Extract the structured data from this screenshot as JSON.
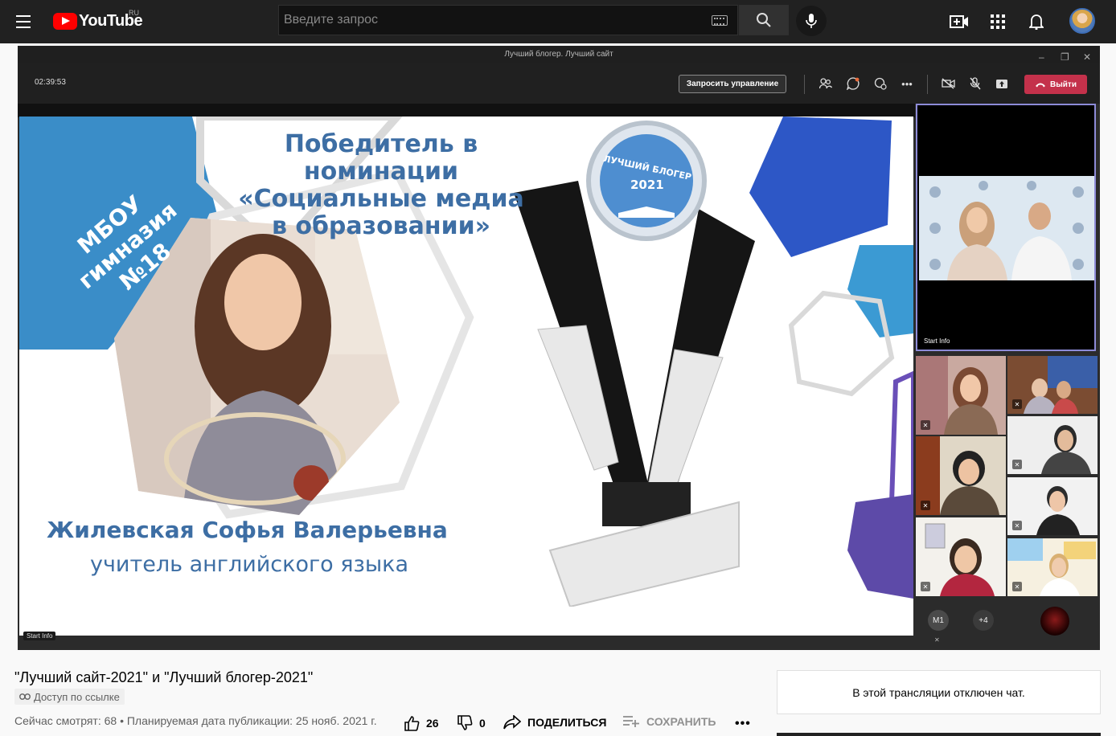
{
  "topbar": {
    "logo_text": "YouTube",
    "region_code": "RU",
    "search_placeholder": "Введите запрос"
  },
  "teams": {
    "window_title": "Лучший блогер. Лучший сайт",
    "timer": "02:39:53",
    "request_control_label": "Запросить управление",
    "leave_label": "Выйти",
    "featured_participant_label": "Start Info",
    "main_tile_label": "Start Info",
    "overflow_count": "+4",
    "initials_badge": "М1"
  },
  "slide": {
    "title_line1": "Победитель в номинации",
    "title_line2": "«Социальные медиа",
    "title_line3": "в образовании»",
    "school_line1": "МБОУ",
    "school_line2": "гимназия",
    "school_line3": "№18",
    "trophy_label_line1": "ЛУЧШИЙ БЛОГЕР",
    "trophy_label_line2": "2021",
    "teacher_name": "Жилевская Софья Валерьевна",
    "teacher_role": "учитель английского языка"
  },
  "video": {
    "title": "\"Лучший сайт-2021\" и \"Лучший блогер-2021\"",
    "access_label": "Доступ по ссылке",
    "meta": "Сейчас смотрят: 68 • Планируемая дата публикации: 25 нояб. 2021 г.",
    "likes": "26",
    "dislikes": "0",
    "share_label": "ПОДЕЛИТЬСЯ",
    "save_label": "СОХРАНИТЬ"
  },
  "chat": {
    "disabled_message": "В этой трансляции отключен чат."
  },
  "colors": {
    "youtube_red": "#ff0000",
    "slide_blue": "#3d6ea4",
    "teams_leave": "#c4314b",
    "featured_border": "#8d8bd8"
  }
}
